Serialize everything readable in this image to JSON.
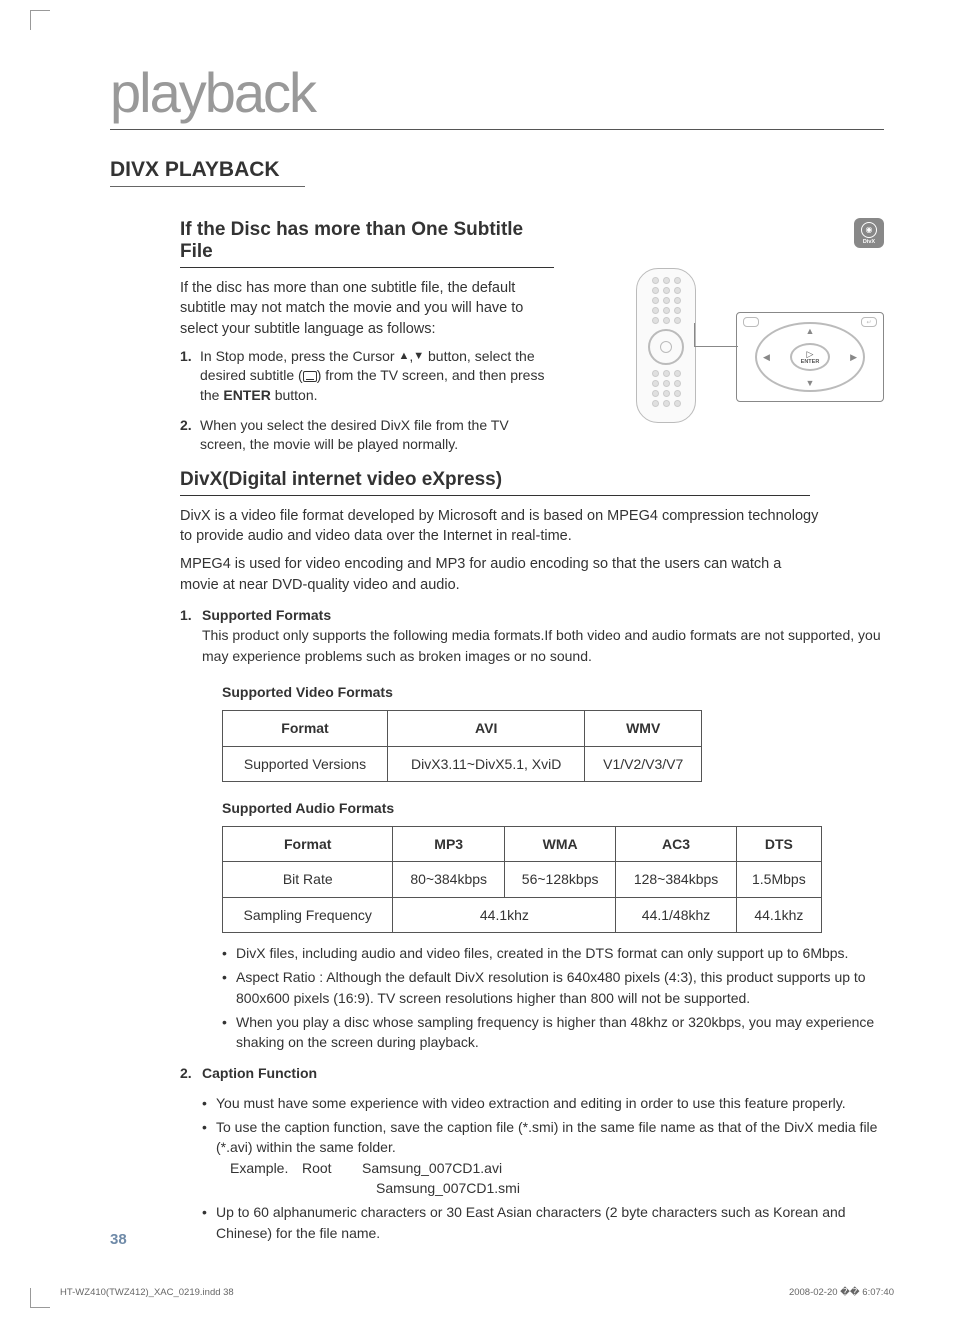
{
  "page": {
    "title_large": "playback",
    "section_heading": "DIVX PLAYBACK",
    "badge_symbol": "◉",
    "badge_label": "DivX",
    "page_number": "38"
  },
  "subtitle_block": {
    "heading": "If the Disc has more than One Subtitle File",
    "para": "If the disc has more than one subtitle file, the default subtitle may not match the movie and you will have to select your subtitle language as follows:",
    "step1_a": "In Stop mode, press the Cursor ",
    "step1_b": " button, select the desired subtitle (",
    "step1_c": ") from the TV screen, and then press the ",
    "step1_enter": "ENTER",
    "step1_d": " button.",
    "step2": "When you select the desired DivX file from the TV screen, the movie will be played normally."
  },
  "navpad": {
    "enter_label": "ENTER"
  },
  "divx_info": {
    "heading": "DivX(Digital internet video eXpress)",
    "p1": "DivX is a video file format developed by Microsoft and is based on MPEG4 compression technology to provide audio and video data over the Internet in real-time.",
    "p2": "MPEG4 is used for video encoding and MP3 for audio encoding so that the users can watch a movie at near DVD-quality video and audio."
  },
  "supported": {
    "num1_title": "Supported Formats",
    "num1_desc": "This product only supports the following media formats.If both video and audio formats are not supported, you may experience problems such as broken images or no sound.",
    "video_title": "Supported Video Formats",
    "audio_title": "Supported Audio Formats"
  },
  "video_table": {
    "h1": "Format",
    "h2": "AVI",
    "h3": "WMV",
    "r1c1": "Supported Versions",
    "r1c2": "DivX3.11~DivX5.1, XviD",
    "r1c3": "V1/V2/V3/V7"
  },
  "audio_table": {
    "h1": "Format",
    "h2": "MP3",
    "h3": "WMA",
    "h4": "AC3",
    "h5": "DTS",
    "r1c1": "Bit Rate",
    "r1c2": "80~384kbps",
    "r1c3": "56~128kbps",
    "r1c4": "128~384kbps",
    "r1c5": "1.5Mbps",
    "r2c1": "Sampling Frequency",
    "r2c2": "44.1khz",
    "r2c4": "44.1/48khz",
    "r2c5": "44.1khz"
  },
  "notes": {
    "b1": "DivX files, including audio and video files, created in the DTS format can only support up to 6Mbps.",
    "b2": "Aspect Ratio : Although the default DivX resolution is 640x480 pixels (4:3), this product supports up to 800x600 pixels (16:9). TV screen resolutions higher than 800 will not be supported.",
    "b3": "When you play a disc whose sampling frequency is higher than 48khz or 320kbps, you may experience shaking on the screen during playback."
  },
  "caption": {
    "num2_title": "Caption Function",
    "b1": "You must have some experience with video extraction and editing in order to use this feature properly.",
    "b2_a": "To use the caption function, save the caption file (*.smi) in the same file name as that of the DivX media file (*.avi) within the same folder.",
    "example_label": "Example.",
    "example_root": "Root",
    "example_f1": "Samsung_007CD1.avi",
    "example_f2": "Samsung_007CD1.smi",
    "b3": "Up to 60 alphanumeric characters or 30 East Asian characters (2 byte characters such as Korean and Chinese) for the file name."
  },
  "footer": {
    "left": "HT-WZ410(TWZ412)_XAC_0219.indd   38",
    "right": "2008-02-20   �� 6:07:40"
  },
  "chart_data": [
    {
      "type": "table",
      "title": "Supported Video Formats",
      "columns": [
        "Format",
        "AVI",
        "WMV"
      ],
      "rows": [
        [
          "Supported Versions",
          "DivX3.11~DivX5.1, XviD",
          "V1/V2/V3/V7"
        ]
      ]
    },
    {
      "type": "table",
      "title": "Supported Audio Formats",
      "columns": [
        "Format",
        "MP3",
        "WMA",
        "AC3",
        "DTS"
      ],
      "rows": [
        [
          "Bit Rate",
          "80~384kbps",
          "56~128kbps",
          "128~384kbps",
          "1.5Mbps"
        ],
        [
          "Sampling Frequency",
          "44.1khz",
          "44.1khz",
          "44.1/48khz",
          "44.1khz"
        ]
      ]
    }
  ]
}
